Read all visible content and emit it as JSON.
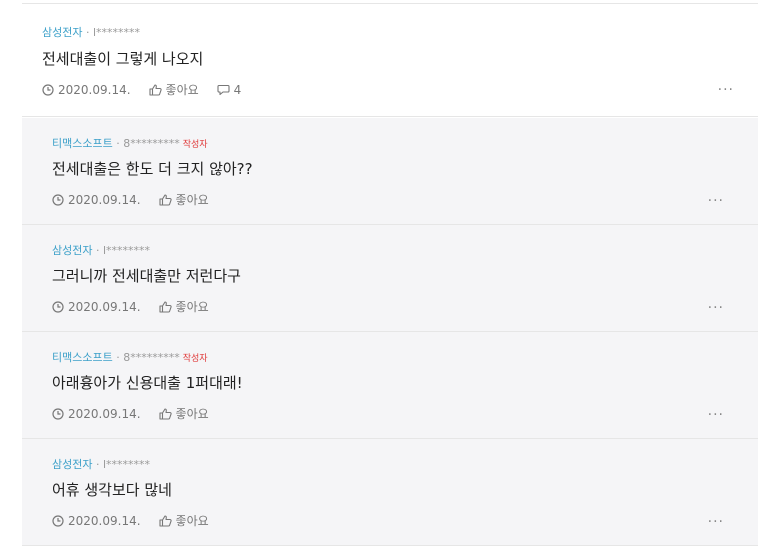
{
  "main_comment": {
    "company": "삼성전자",
    "separator": " · ",
    "user": "l********",
    "text": "전세대출이 그렇게 나오지",
    "date": "2020.09.14.",
    "like_label": "좋아요",
    "reply_count": "4",
    "more": "···"
  },
  "replies": [
    {
      "company": "티맥스소프트",
      "separator": " · ",
      "user": "8*********",
      "author_badge": "작성자",
      "text": "전세대출은 한도 더 크지 않아??",
      "date": "2020.09.14.",
      "like_label": "좋아요",
      "more": "···"
    },
    {
      "company": "삼성전자",
      "separator": " · ",
      "user": "l********",
      "text": "그러니까 전세대출만 저런다구",
      "date": "2020.09.14.",
      "like_label": "좋아요",
      "more": "···"
    },
    {
      "company": "티맥스소프트",
      "separator": " · ",
      "user": "8*********",
      "author_badge": "작성자",
      "text": "아래흉아가 신용대출 1퍼대래!",
      "date": "2020.09.14.",
      "like_label": "좋아요",
      "more": "···"
    },
    {
      "company": "삼성전자",
      "separator": " · ",
      "user": "l********",
      "text": "어휴 생각보다 많네",
      "date": "2020.09.14.",
      "like_label": "좋아요",
      "more": "···"
    }
  ],
  "colors": {
    "company": "#3ca0c9",
    "author_badge": "#e03a3a",
    "reply_background": "#f5f5f7"
  },
  "icons": {
    "date": "clock-icon",
    "like": "thumbs-up-icon",
    "reply": "speech-bubble-icon",
    "more": "ellipsis-icon"
  }
}
